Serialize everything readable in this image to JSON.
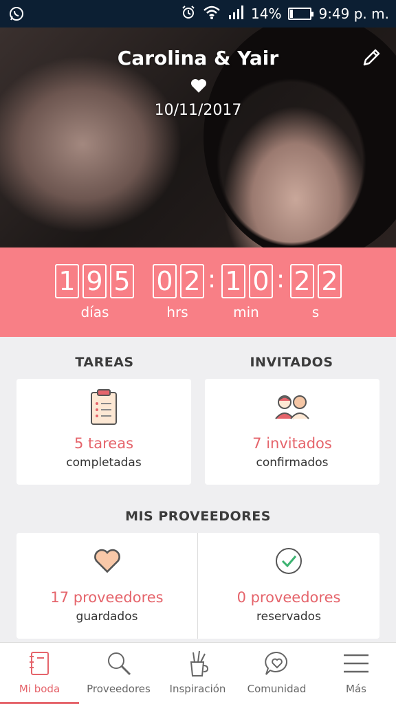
{
  "status_bar": {
    "battery": "14%",
    "battery_level": 0.14,
    "time": "9:49 p. m."
  },
  "hero": {
    "couple": "Carolina & Yair",
    "date": "10/11/2017"
  },
  "countdown": {
    "days": [
      "1",
      "9",
      "5"
    ],
    "hours": [
      "0",
      "2"
    ],
    "minutes": [
      "1",
      "0"
    ],
    "seconds": [
      "2",
      "2"
    ],
    "days_label": "días",
    "hours_label": "hrs",
    "minutes_label": "min",
    "seconds_label": "s"
  },
  "tasks": {
    "title": "TAREAS",
    "count": "5 tareas",
    "sub": "completadas"
  },
  "guests": {
    "title": "INVITADOS",
    "count": "7 invitados",
    "sub": "confirmados"
  },
  "vendors": {
    "title": "MIS PROVEEDORES",
    "saved_count": "17 proveedores",
    "saved_sub": "guardados",
    "booked_count": "0 proveedores",
    "booked_sub": "reservados"
  },
  "nav": [
    {
      "label": "Mi boda",
      "icon": "notebook-icon",
      "active": true
    },
    {
      "label": "Proveedores",
      "icon": "search-icon",
      "active": false
    },
    {
      "label": "Inspiración",
      "icon": "pencil-cup-icon",
      "active": false
    },
    {
      "label": "Comunidad",
      "icon": "chat-heart-icon",
      "active": false
    },
    {
      "label": "Más",
      "icon": "menu-icon",
      "active": false
    }
  ],
  "colors": {
    "accent": "#e5646b",
    "countdown_bg": "#f87f86",
    "status_bar": "#0c1f33"
  }
}
